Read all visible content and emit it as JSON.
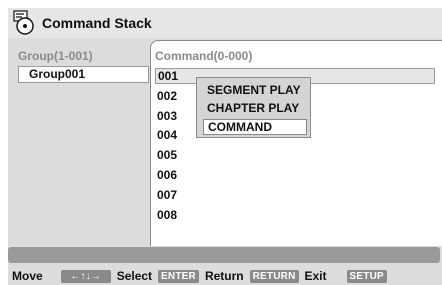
{
  "title": "Command Stack",
  "group_panel": {
    "header": "Group(1-001)",
    "items": [
      "Group001"
    ]
  },
  "command_panel": {
    "header": "Command(0-000)",
    "rows": [
      "001",
      "002",
      "003",
      "004",
      "005",
      "006",
      "007",
      "008"
    ],
    "selected_index": 0
  },
  "popup_menu": {
    "items": [
      "SEGMENT PLAY",
      "CHAPTER PLAY",
      "COMMAND"
    ],
    "selected_index": 2
  },
  "help_bar": {
    "move_label": "Move",
    "move_key": "←↑↓→",
    "select_label": "Select",
    "select_key": "ENTER",
    "return_label": "Return",
    "return_key": "RETURN",
    "exit_label": "Exit",
    "exit_key": "SETUP"
  },
  "colors": {
    "background": "#dcdcdc",
    "panel": "#ffffff",
    "status_bar": "#9a9a9a",
    "key_button": "#8a8a8a"
  }
}
